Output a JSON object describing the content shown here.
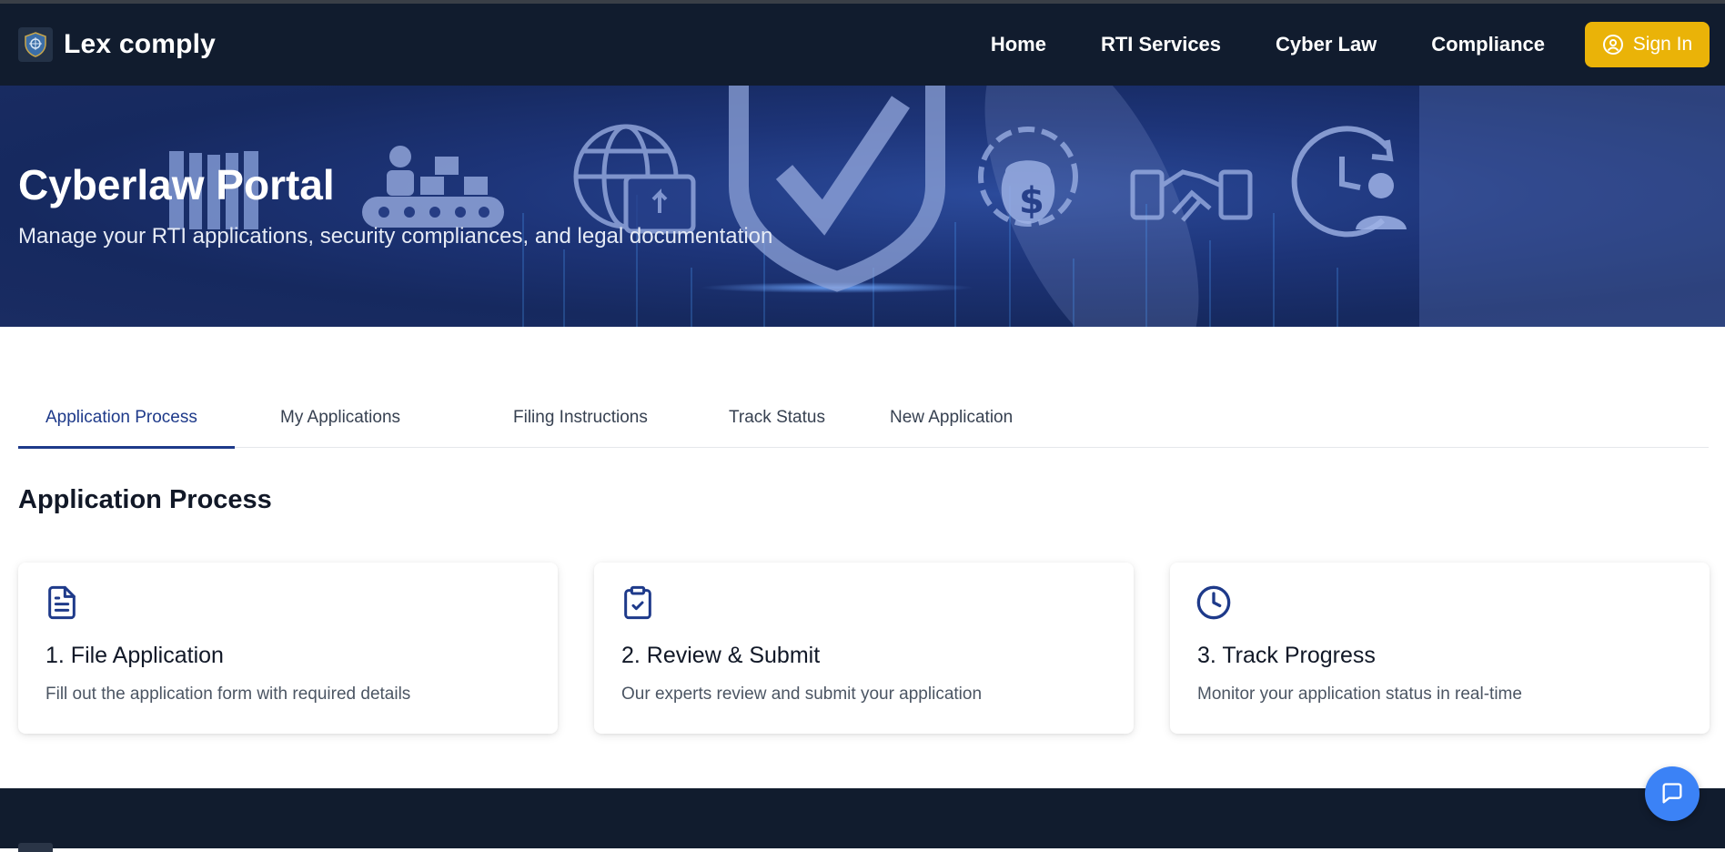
{
  "navbar": {
    "brand": "Lex comply",
    "links": [
      "Home",
      "RTI Services",
      "Cyber Law",
      "Compliance"
    ],
    "signin_label": "Sign In"
  },
  "hero": {
    "title": "Cyberlaw Portal",
    "subtitle": "Manage your RTI applications, security compliances, and legal documentation"
  },
  "tabs": [
    "Application Process",
    "My Applications",
    "Filing Instructions",
    "Track Status",
    "New Application"
  ],
  "active_tab": "Application Process",
  "section": {
    "title": "Application Process"
  },
  "cards": [
    {
      "icon": "document-icon",
      "title": "1. File Application",
      "desc": "Fill out the application form with required details"
    },
    {
      "icon": "clipboard-check-icon",
      "title": "2. Review & Submit",
      "desc": "Our experts review and submit your application"
    },
    {
      "icon": "clock-icon",
      "title": "3. Track Progress",
      "desc": "Monitor your application status in real-time"
    }
  ],
  "colors": {
    "navbar_bg": "#111c2e",
    "accent_yellow": "#eab308",
    "primary_blue": "#1e3a8a",
    "chat_blue": "#3b82f6"
  }
}
